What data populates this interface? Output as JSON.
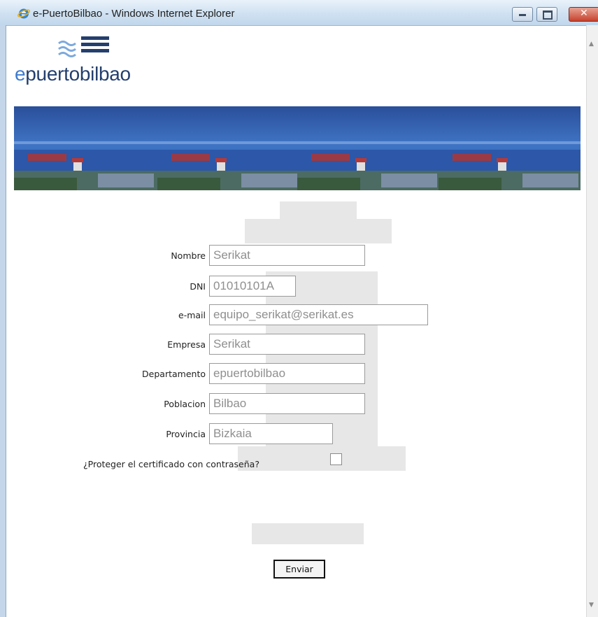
{
  "window": {
    "title": "e-PuertoBilbao - Windows Internet Explorer",
    "icon": "internet-explorer-icon"
  },
  "brand": {
    "logo_prefix": "e",
    "logo_rest": "puertobilbao",
    "colors": {
      "primary": "#243f6e",
      "accent": "#3f7ccf"
    }
  },
  "form": {
    "fields": [
      {
        "label": "Nombre",
        "value": "Serikat"
      },
      {
        "label": "DNI",
        "value": "01010101A"
      },
      {
        "label": "e-mail",
        "value": "equipo_serikat@serikat.es"
      },
      {
        "label": "Empresa",
        "value": "Serikat"
      },
      {
        "label": "Departamento",
        "value": "epuertobilbao"
      },
      {
        "label": "Poblacion",
        "value": "Bilbao"
      },
      {
        "label": "Provincia",
        "value": "Bizkaia"
      }
    ],
    "checkbox_label": "¿Proteger el certificado con contraseña?",
    "checkbox_checked": false,
    "submit_label": "Enviar"
  }
}
